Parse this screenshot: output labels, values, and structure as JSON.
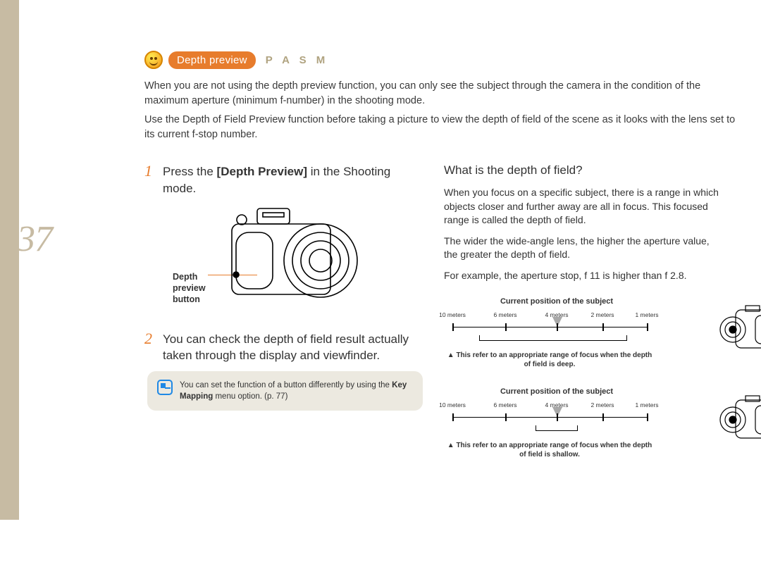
{
  "page_number": "37",
  "header": {
    "title_badge": "Depth preview",
    "mode_letters": "P A S M"
  },
  "intro": {
    "p1": "When you are not using the depth preview function, you can only see the subject through the camera in the condition of the maximum aperture (minimum f-number) in the shooting mode.",
    "p2": "Use the Depth of Field Preview function before taking a picture to view the depth of field of the scene as it looks with the lens set to its current f-stop number."
  },
  "steps": {
    "s1_pre": "Press the ",
    "s1_bold": "[Depth Preview]",
    "s1_post": " in the Shooting mode.",
    "camera_label_l1": "Depth",
    "camera_label_l2": "preview",
    "camera_label_l3": "button",
    "s2": "You can check the depth of field result actually taken through the display and viewfinder."
  },
  "note": {
    "pre": "You can set the function of a button differently by using the ",
    "bold": "Key Mapping",
    "post": " menu option. (p. 77)"
  },
  "right": {
    "heading": "What is the depth of field?",
    "p1": "When you focus on a specific subject, there is a range in which objects closer and further away are all in focus. This focused range is called the depth of field.",
    "p2": "The wider the wide-angle lens, the higher the aperture value, the greater the depth of field.",
    "p3": "For example, the aperture stop, f 11 is higher than f 2.8."
  },
  "dof": {
    "title": "Current position of the subject",
    "ticks": [
      "10 meters",
      "6 meters",
      "4 meters",
      "2 meters",
      "1 meters"
    ],
    "caption_deep": "This refer to an appropriate range of focus when the depth of field is deep.",
    "caption_shallow": "This refer to an appropriate range of focus when the depth of field is shallow."
  }
}
